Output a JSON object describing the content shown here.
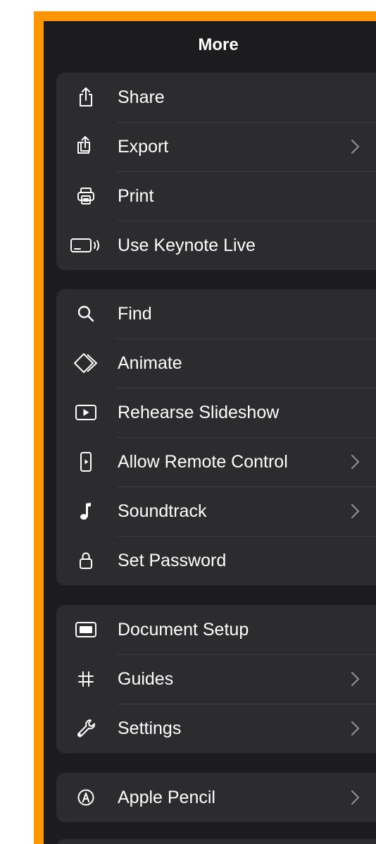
{
  "header": {
    "title": "More"
  },
  "groups": [
    {
      "items": [
        {
          "label": "Share",
          "icon": "share-icon",
          "chevron": false
        },
        {
          "label": "Export",
          "icon": "export-icon",
          "chevron": true
        },
        {
          "label": "Print",
          "icon": "printer-icon",
          "chevron": false
        },
        {
          "label": "Use Keynote Live",
          "icon": "keynote-live-icon",
          "chevron": false
        }
      ]
    },
    {
      "items": [
        {
          "label": "Find",
          "icon": "search-icon",
          "chevron": false
        },
        {
          "label": "Animate",
          "icon": "animate-icon",
          "chevron": false
        },
        {
          "label": "Rehearse Slideshow",
          "icon": "play-icon",
          "chevron": false
        },
        {
          "label": "Allow Remote Control",
          "icon": "remote-icon",
          "chevron": true
        },
        {
          "label": "Soundtrack",
          "icon": "music-note-icon",
          "chevron": true
        },
        {
          "label": "Set Password",
          "icon": "lock-icon",
          "chevron": false
        }
      ]
    },
    {
      "items": [
        {
          "label": "Document Setup",
          "icon": "document-setup-icon",
          "chevron": false
        },
        {
          "label": "Guides",
          "icon": "hashtag-icon",
          "chevron": true
        },
        {
          "label": "Settings",
          "icon": "wrench-icon",
          "chevron": true
        }
      ]
    },
    {
      "items": [
        {
          "label": "Apple Pencil",
          "icon": "pencil-icon",
          "chevron": true
        }
      ]
    }
  ],
  "colors": {
    "accent_border": "#ff9500",
    "panel_background": "#1c1c1e",
    "group_background": "#2c2c2e",
    "text": "#ffffff",
    "chevron": "#8e8e93"
  }
}
